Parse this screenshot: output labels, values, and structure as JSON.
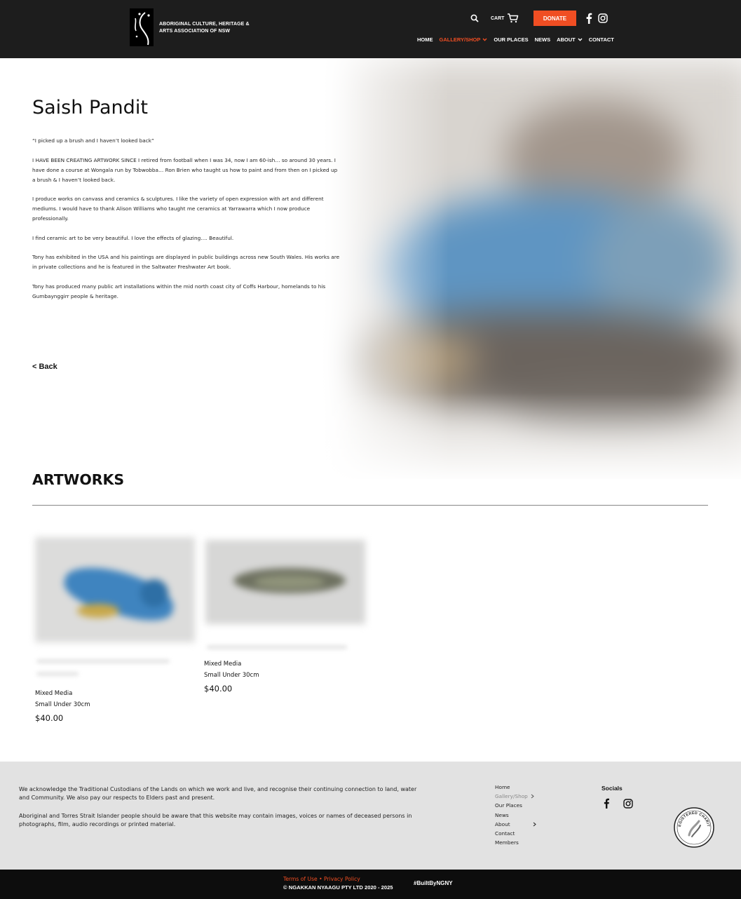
{
  "header": {
    "org_name": "ABORIGINAL CULTURE, HERITAGE & ARTS ASSOCIATION OF NSW",
    "cart_label": "CART",
    "donate_label": "DONATE",
    "nav": [
      {
        "label": "HOME",
        "active": false
      },
      {
        "label": "GALLERY/SHOP",
        "active": true,
        "dropdown": true
      },
      {
        "label": "OUR PLACES",
        "active": false
      },
      {
        "label": "NEWS",
        "active": false
      },
      {
        "label": "ABOUT",
        "active": false,
        "dropdown": true
      },
      {
        "label": "CONTACT",
        "active": false
      }
    ],
    "accent_color": "#f04e23"
  },
  "artist": {
    "name": "Saish Pandit",
    "bio": [
      "“I picked up a brush and I haven’t looked back”",
      "I HAVE BEEN CREATING ARTWORK SINCE I retired from football when I was 34, now I am 60-ish… so around 30 years. I have done a course at Wongala run by Tobwobba… Ron Brien who taught us how to paint and from then on I picked up a brush & I haven’t looked back.",
      "I produce works on canvass and ceramics & sculptures. I like the variety of open expression with art and different mediums. I would have to thank Alison Williams who taught me ceramics at Yarrawarra which I now produce professionally.",
      "I find ceramic art to be very beautiful. I love the effects of glazing…. Beautiful.",
      "Tony has exhibited in the USA and his paintings are displayed in public buildings across new South Wales. His works are in private collections and he is featured in the Saltwater Freshwater Art book.",
      "Tony has produced many public art installations within the mid north coast city of Coffs Harbour, homelands to his Gumbaynggirr people & heritage."
    ],
    "back_label": "< Back"
  },
  "artworks": {
    "heading": "ARTWORKS",
    "items": [
      {
        "medium": "Mixed Media",
        "size": "Small Under 30cm",
        "price": "$40.00"
      },
      {
        "medium": "Mixed Media",
        "size": "Small Under 30cm",
        "price": "$40.00"
      }
    ]
  },
  "footer": {
    "acknowledgement": "We acknowledge the Traditional Custodians of the Lands on which we work and live, and recognise their continuing connection to land, water and Community. We also pay our respects to Elders past and present.",
    "warning": "Aboriginal and Torres Strait Islander people should be aware that this website may contain images, voices or names of deceased persons in photographs, film, audio recordings or printed material.",
    "links": [
      {
        "label": "Home",
        "active": false,
        "chevron": false
      },
      {
        "label": "Gallery/Shop",
        "active": true,
        "chevron": true
      },
      {
        "label": "Our Places",
        "active": false,
        "chevron": false
      },
      {
        "label": "News",
        "active": false,
        "chevron": false
      },
      {
        "label": "About",
        "active": false,
        "chevron": true
      },
      {
        "label": "Contact",
        "active": false,
        "chevron": false
      },
      {
        "label": "Members",
        "active": false,
        "chevron": false
      }
    ],
    "socials_title": "Socials",
    "charity_badge_text": "REGISTERED CHARITY",
    "terms_label": "Terms of Use",
    "separator": "•",
    "privacy_label": "Privacy Policy",
    "copyright": "© NGAKKAN NYAAGU PTY LTD 2020 - 2025",
    "built_by": "#BuiltByNGNY"
  }
}
